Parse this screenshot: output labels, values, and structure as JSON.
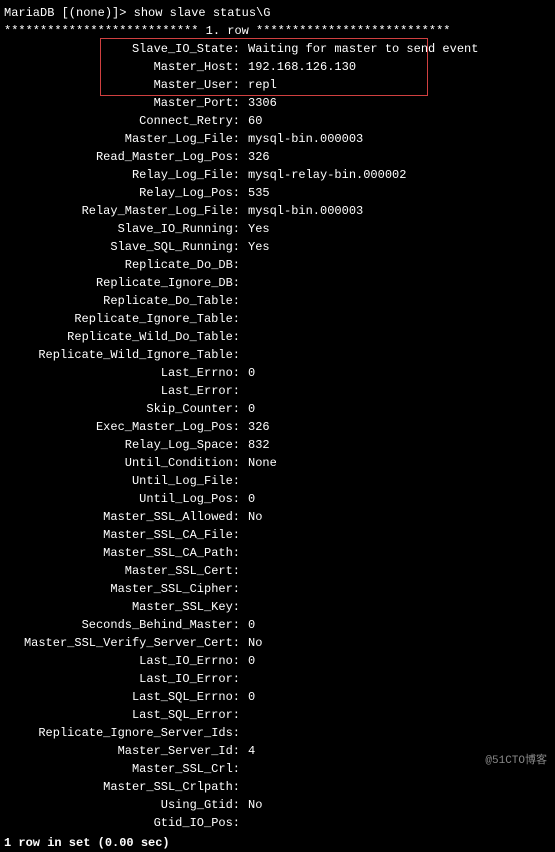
{
  "prompt": {
    "prefix": "MariaDB [(none)]>",
    "command": "show slave status\\G"
  },
  "row_separator": "*************************** 1. row ***************************",
  "fields": [
    {
      "label": "Slave_IO_State",
      "value": "Waiting for master to send event"
    },
    {
      "label": "Master_Host",
      "value": "192.168.126.130"
    },
    {
      "label": "Master_User",
      "value": "repl"
    },
    {
      "label": "Master_Port",
      "value": "3306"
    },
    {
      "label": "Connect_Retry",
      "value": "60"
    },
    {
      "label": "Master_Log_File",
      "value": "mysql-bin.000003"
    },
    {
      "label": "Read_Master_Log_Pos",
      "value": "326"
    },
    {
      "label": "Relay_Log_File",
      "value": "mysql-relay-bin.000002"
    },
    {
      "label": "Relay_Log_Pos",
      "value": "535"
    },
    {
      "label": "Relay_Master_Log_File",
      "value": "mysql-bin.000003"
    },
    {
      "label": "Slave_IO_Running",
      "value": "Yes"
    },
    {
      "label": "Slave_SQL_Running",
      "value": "Yes"
    },
    {
      "label": "Replicate_Do_DB",
      "value": ""
    },
    {
      "label": "Replicate_Ignore_DB",
      "value": ""
    },
    {
      "label": "Replicate_Do_Table",
      "value": ""
    },
    {
      "label": "Replicate_Ignore_Table",
      "value": ""
    },
    {
      "label": "Replicate_Wild_Do_Table",
      "value": ""
    },
    {
      "label": "Replicate_Wild_Ignore_Table",
      "value": ""
    },
    {
      "label": "Last_Errno",
      "value": "0"
    },
    {
      "label": "Last_Error",
      "value": ""
    },
    {
      "label": "Skip_Counter",
      "value": "0"
    },
    {
      "label": "Exec_Master_Log_Pos",
      "value": "326"
    },
    {
      "label": "Relay_Log_Space",
      "value": "832"
    },
    {
      "label": "Until_Condition",
      "value": "None"
    },
    {
      "label": "Until_Log_File",
      "value": ""
    },
    {
      "label": "Until_Log_Pos",
      "value": "0"
    },
    {
      "label": "Master_SSL_Allowed",
      "value": "No"
    },
    {
      "label": "Master_SSL_CA_File",
      "value": ""
    },
    {
      "label": "Master_SSL_CA_Path",
      "value": ""
    },
    {
      "label": "Master_SSL_Cert",
      "value": ""
    },
    {
      "label": "Master_SSL_Cipher",
      "value": ""
    },
    {
      "label": "Master_SSL_Key",
      "value": ""
    },
    {
      "label": "Seconds_Behind_Master",
      "value": "0"
    },
    {
      "label": "Master_SSL_Verify_Server_Cert",
      "value": "No"
    },
    {
      "label": "Last_IO_Errno",
      "value": "0"
    },
    {
      "label": "Last_IO_Error",
      "value": ""
    },
    {
      "label": "Last_SQL_Errno",
      "value": "0"
    },
    {
      "label": "Last_SQL_Error",
      "value": ""
    },
    {
      "label": "Replicate_Ignore_Server_Ids",
      "value": ""
    },
    {
      "label": "Master_Server_Id",
      "value": "4"
    },
    {
      "label": "Master_SSL_Crl",
      "value": ""
    },
    {
      "label": "Master_SSL_Crlpath",
      "value": ""
    },
    {
      "label": "Using_Gtid",
      "value": "No"
    },
    {
      "label": "Gtid_IO_Pos",
      "value": ""
    }
  ],
  "footer": "1 row in set (0.00 sec)",
  "watermark": "@51CTO博客"
}
